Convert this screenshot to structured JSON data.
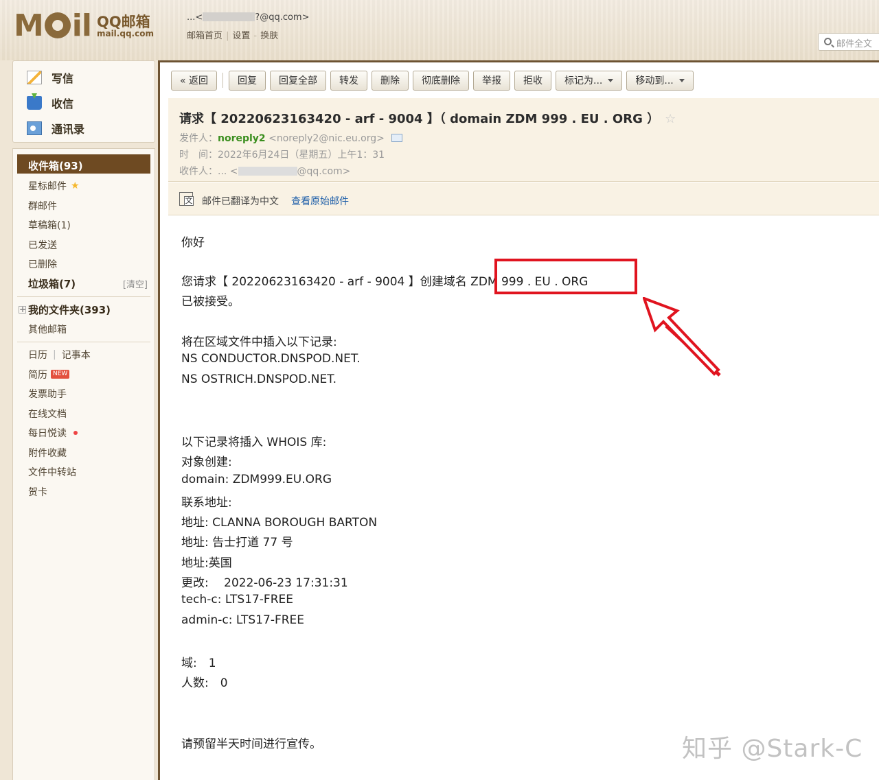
{
  "header": {
    "logo_word": "MOil",
    "logo_brand": "QQ邮箱",
    "logo_domain": "mail.qq.com",
    "account_prefix": "...<",
    "account_suffix": "?@qq.com>",
    "links": [
      "邮箱首页",
      "设置",
      "换肤"
    ],
    "search_placeholder": "邮件全文"
  },
  "quick_actions": [
    {
      "label": "写信",
      "icon": "compose-icon"
    },
    {
      "label": "收信",
      "icon": "receive-icon"
    },
    {
      "label": "通讯录",
      "icon": "contacts-icon"
    }
  ],
  "sidebar": {
    "inbox": "收件箱(93)",
    "items": [
      {
        "label": "星标邮件"
      },
      {
        "label": "群邮件"
      },
      {
        "label": "草稿箱(1)"
      },
      {
        "label": "已发送"
      },
      {
        "label": "已删除"
      },
      {
        "label": "垃圾箱(7)",
        "action": "[清空]"
      }
    ],
    "my_folders": "我的文件夹(393)",
    "other_mail": "其他邮箱",
    "calendar": "日历",
    "notes": "记事本",
    "tools": [
      {
        "label": "简历",
        "badge": "NEW"
      },
      {
        "label": "发票助手"
      },
      {
        "label": "在线文档"
      },
      {
        "label": "每日悦读"
      },
      {
        "label": "附件收藏"
      },
      {
        "label": "文件中转站"
      },
      {
        "label": "贺卡"
      }
    ]
  },
  "toolbar": {
    "back": "« 返回",
    "buttons": [
      "回复",
      "回复全部",
      "转发",
      "删除",
      "彻底删除",
      "举报",
      "拒收"
    ],
    "mark_as": "标记为...",
    "move_to": "移动到..."
  },
  "mail": {
    "subject": "请求【 20220623163420 - arf - 9004 】（ domain ZDM 999 . EU . ORG ）",
    "sender_label": "发件人：",
    "sender_name": "noreply2",
    "sender_email": "<noreply2@nic.eu.org>",
    "time_label": "时　间：",
    "time_value": "2022年6月24日（星期五）上午1：31",
    "to_label": "收件人：",
    "to_prefix": "... <",
    "to_suffix": "@qq.com>",
    "translated_note": "邮件已翻译为中文",
    "view_original": "查看原始邮件",
    "body": [
      "你好",
      "您请求【 20220623163420 - arf - 9004 】创建域名 ZDM 999 . EU . ORG",
      "已被接受。",
      "将在区域文件中插入以下记录:",
      "NS CONDUCTOR.DNSPOD.NET.",
      "NS OSTRICH.DNSPOD.NET.",
      "以下记录将插入 WHOIS 库:",
      "对象创建:",
      "domain: ZDM999.EU.ORG",
      "联系地址:",
      "地址: CLANNA BOROUGH BARTON",
      "地址: 告士打道 77 号",
      "地址:英国",
      "更改:　 2022-06-23 17:31:31",
      "tech-c: LTS17-FREE",
      "admin-c: LTS17-FREE",
      "域:　1",
      "人数:　0",
      "请预留半天时间进行宣传。"
    ]
  },
  "watermark": "知乎 @Stark-C",
  "colors": {
    "annotation": "#e0141f",
    "sender": "#3a8e1e",
    "link": "#1e5fa9",
    "inbox_bg": "#6e4a22"
  }
}
